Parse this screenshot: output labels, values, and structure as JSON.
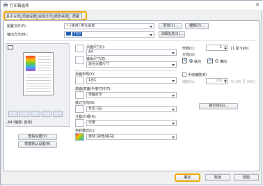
{
  "window": {
    "title": "打印首选项"
  },
  "tabs": [
    {
      "label": "基本设置",
      "active": true
    },
    {
      "label": "页面设置",
      "active": false
    },
    {
      "label": "完成方式",
      "active": false
    },
    {
      "label": "纸张来源",
      "active": false
    },
    {
      "label": "质量",
      "active": false
    }
  ],
  "profile": {
    "label": "配置文件(F):",
    "value": "(更改) 默认设置",
    "add_button": "添加(1)...",
    "edit_button": "编辑(2)..."
  },
  "output": {
    "label": "输出方法(M):",
    "value": "打印",
    "details_button": "详细信息(3)..."
  },
  "preview": {
    "caption": "A4 (缩放: 自动)",
    "view_settings_button": "查看设置(V)",
    "restore_defaults_button": "恢复默认设置(R)"
  },
  "page_size": {
    "label": "页面尺寸(I):",
    "value": "A4"
  },
  "output_size": {
    "label": "输出尺寸(Z):",
    "value": "适合页面尺寸"
  },
  "copies": {
    "label": "份数(C):",
    "value": "1",
    "range": "[1 至 999]"
  },
  "orientation": {
    "label": "方向(O)",
    "portrait": "纵向",
    "landscape": "横向",
    "selected": "portrait"
  },
  "layout": {
    "label": "页面布局(Y):",
    "value": "1合1"
  },
  "manual_scaling": {
    "label": "手动缩放(E)",
    "scale_label": "缩放(S):",
    "scale_value": "100",
    "range": "% [25 至 200]"
  },
  "duplex": {
    "label": "单面/双面/手册打印(T):",
    "value": "单面打印"
  },
  "binding": {
    "label": "装订方向(B):",
    "value": "长边 [左]",
    "binding_button": "装订线(G)..."
  },
  "collate": {
    "label": "分套/分组(R):",
    "value": "分套"
  },
  "color_mode": {
    "label": "色彩模式(C):",
    "value": "自动 [彩色/黑白]"
  },
  "footer": {
    "ok": "确定",
    "cancel": "取消",
    "help": "帮助"
  },
  "colors": {
    "accent": "#f0a800",
    "link": "#1a5fb4"
  }
}
